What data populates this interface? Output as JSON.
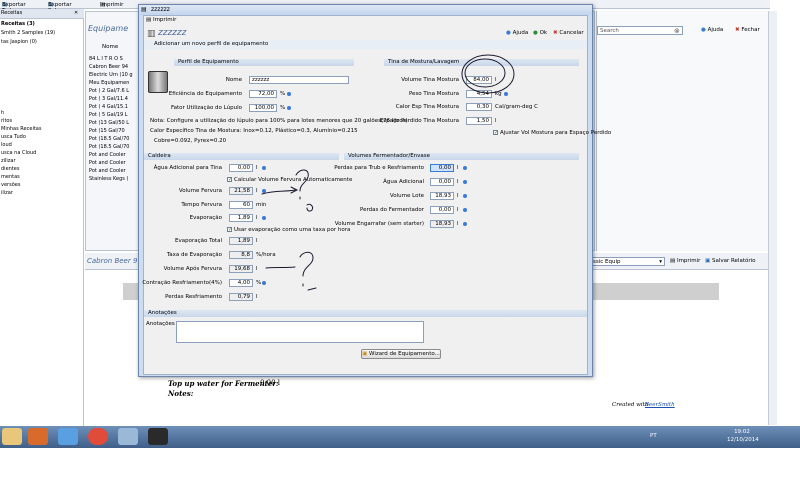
{
  "toolbar": {
    "items": [
      "Exportar Tudo",
      "Exportar Sel",
      "Imprimir",
      "Receitas",
      "Ajuda",
      "Fechar"
    ],
    "search_placeholder": "Search"
  },
  "sidebar": {
    "header": "Receitas",
    "items": [
      "Receitas (3)",
      "Smith 2 Samples (19)",
      "tas Jaspion (0)",
      "h",
      "ritos",
      "Minhas Receitas",
      "usca Tudo",
      "loud",
      "usca na Cloud",
      "zilizar",
      "dientes",
      "mentas",
      "versões",
      "ilizar"
    ]
  },
  "background": {
    "panel_title": "Equipame",
    "column_name": "Nome",
    "list": [
      "84 L I T R O S",
      "Cabron Beer 94",
      "Electric Urn (10 g",
      "Meu Equipamen",
      "Pot ( 2 Gal/7.6 L",
      "Pot ( 3 Gal/11.4",
      "Pot ( 4 Gal/15.1",
      "Pot ( 5 Gal/19 L",
      "Pot (13 Gal/50 L",
      "Pot (15 Gal/70",
      "Pot (18.5 Gal/70",
      "Pot (18.5 Gal/70",
      "Pot and Cooler",
      "Pot and Cooler",
      "Pot and Cooler",
      "Stainless Kegs ("
    ],
    "lower_title": "Cabron Beer 9",
    "lower_dropdown": "ssic Equip",
    "lower_print": "Imprimir",
    "lower_save": "Salvar Relatório",
    "report_line1": "Top up water for Fermenter:",
    "report_val1": "0,00 l",
    "report_line2": "Notes:",
    "created_with": "Created with",
    "created_link": "BeerSmith",
    "right_ajuda": "Ajuda",
    "right_fechar": "Fechar"
  },
  "taskbar": {
    "lang": "PT",
    "time": "19:02",
    "date": "12/10/2014"
  },
  "dialog": {
    "title": "zzzzzz",
    "print": "Imprimir",
    "name_display": "zzzzzz",
    "ajuda": "Ajuda",
    "ok": "Ok",
    "cancelar": "Cancelar",
    "subtitle": "Adicionar um novo perfil de equipamento",
    "perfil": {
      "header": "Perfil de Equipamento",
      "nome_label": "Nome",
      "nome_value": "zzzzzz",
      "eficiencia_label": "Eficiência do Equipamento",
      "eficiencia_value": "72,00",
      "eficiencia_unit": "%",
      "lupulo_label": "Fator Utilização do Lúpulo",
      "lupulo_value": "100,00",
      "lupulo_unit": "%"
    },
    "note1": "Nota: Configure a utilização do lúpulo para 100% para lotes menores que 20 galões(76 litros)",
    "note2": "Calor Específico Tina de Mostura: Inox=0.12, Plástico=0.3, Alumínio=0.215",
    "note3": "Cobre=0.092, Pyrex=0.20",
    "tina": {
      "header": "Tina de Mostura/Lavagem",
      "volume_label": "Volume Tina Mostura",
      "volume_value": "84,00",
      "volume_unit": "l",
      "peso_label": "Peso Tina Mostura",
      "peso_value": "4,54",
      "peso_unit": "kg",
      "calor_label": "Calor Esp Tina Mostura",
      "calor_value": "0,30",
      "calor_unit": "Cal/gram-deg C",
      "espaco_label": "Espaço Perdido Tina Mostura",
      "espaco_value": "1,50",
      "espaco_unit": "l",
      "ajustar_label": "Ajustar Vol Mostura para Espaço Perdido"
    },
    "caldeira": {
      "header": "Caldeira",
      "agua_label": "Água Adicional para Tina",
      "agua_value": "0,00",
      "agua_unit": "l",
      "calc_label": "Calcular Volume Fervura Automaticamente",
      "vol_fervura_label": "Volume Fervura",
      "vol_fervura_value": "21,58",
      "vol_fervura_unit": "l",
      "tempo_label": "Tempo Fervura",
      "tempo_value": "60",
      "tempo_unit": "min",
      "evap_label": "Evaporação",
      "evap_value": "1,89",
      "evap_unit": "l",
      "usar_evap_label": "Usar evaporação como uma taxa por hora",
      "evap_total_label": "Evaporação Total",
      "evap_total_value": "1,89",
      "evap_total_unit": "l",
      "taxa_label": "Taxa de Evaporação",
      "taxa_value": "8,8",
      "taxa_unit": "%/hora",
      "vol_apos_label": "Volume Após Fervura",
      "vol_apos_value": "19,68",
      "vol_apos_unit": "l",
      "contracao_label": "Contração Resfriamento(4%)",
      "contracao_value": "4,00",
      "contracao_unit": "%",
      "perdas_label": "Perdas Resfriamento",
      "perdas_value": "0,79",
      "perdas_unit": "l"
    },
    "fermentador": {
      "header": "Volumes Fermentador/Envase",
      "perdas_trub_label": "Perdas para Trub e Resfriamento",
      "perdas_trub_value": "0,00",
      "perdas_trub_unit": "l",
      "agua_label": "Água Adicional",
      "agua_value": "0,00",
      "agua_unit": "l",
      "lote_label": "Volume Lote",
      "lote_value": "18,93",
      "lote_unit": "l",
      "perdas_ferm_label": "Perdas do Fermentador",
      "perdas_ferm_value": "0,00",
      "perdas_ferm_unit": "l",
      "engarrafar_label": "Volume Engarrafar (sem starter)",
      "engarrafar_value": "18,93",
      "engarrafar_unit": "l"
    },
    "anotacoes": {
      "header": "Anotações",
      "label": "Anotações",
      "value": ""
    },
    "wizard_button": "Wizard de Equipamento..."
  },
  "colors": {
    "dialog_frame": "#cddcf0",
    "accent_blue": "#3a7bd5",
    "ink": "#1a1a2e"
  }
}
